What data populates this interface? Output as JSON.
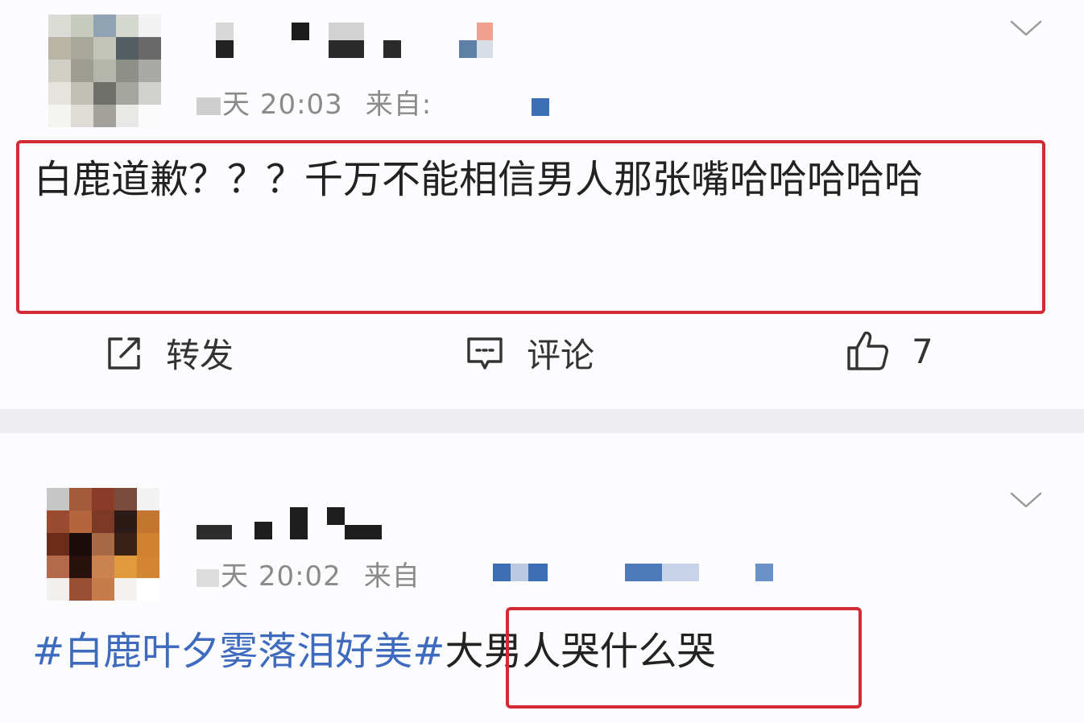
{
  "posts": [
    {
      "time_prefix": "天",
      "time": "20:03",
      "source_prefix": "来自:",
      "content": "白鹿道歉？？？千万不能相信男人那张嘴哈哈哈哈哈",
      "actions": {
        "repost_label": "转发",
        "comment_label": "评论",
        "like_count": "7"
      }
    },
    {
      "time_prefix": "天",
      "time": "20:02",
      "source_prefix": "来自",
      "hashtag": "#白鹿叶夕雾落泪好美#",
      "content": "大男人哭什么哭"
    }
  ],
  "colors": {
    "highlight_border": "#d42a36",
    "hashtag": "#3f6bbf",
    "meta_text": "#8a8a8a",
    "separator": "#eeeef2"
  },
  "icons": [
    "chevron-down-icon",
    "repost-icon",
    "comment-icon",
    "thumbs-up-icon"
  ]
}
